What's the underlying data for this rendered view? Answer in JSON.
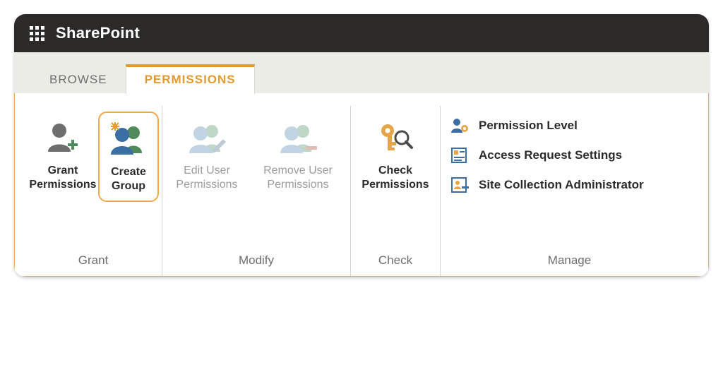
{
  "app": {
    "title": "SharePoint"
  },
  "tabs": {
    "browse": "BROWSE",
    "permissions": "PERMISSIONS"
  },
  "groups": {
    "grant": {
      "label": "Grant",
      "items": {
        "grant_permissions": "Grant Permissions",
        "create_group": "Create Group"
      }
    },
    "modify": {
      "label": "Modify",
      "items": {
        "edit_user_permissions": "Edit User Permissions",
        "remove_user_permissions": "Remove User Permissions"
      }
    },
    "check": {
      "label": "Check",
      "items": {
        "check_permissions": "Check Permissions"
      }
    },
    "manage": {
      "label": "Manage",
      "items": {
        "permission_level": "Permission Level",
        "access_request_settings": "Access Request Settings",
        "site_collection_admin": "Site Collection Administrator"
      }
    }
  },
  "colors": {
    "accent": "#e39b2f",
    "border_selected": "#f0a94a",
    "muted": "#6e6e6e",
    "disabled": "#9c9c9c"
  }
}
